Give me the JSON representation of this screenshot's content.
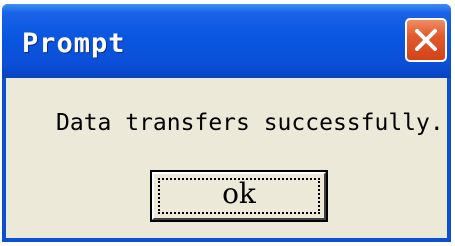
{
  "dialog": {
    "title": "Prompt",
    "close_icon": "close-x-icon",
    "message": "Data transfers successfully.",
    "ok_label": "ok"
  },
  "colors": {
    "titlebar": "#0a56e0",
    "close_button": "#e35a2c",
    "dialog_face": "#ece9d8"
  }
}
